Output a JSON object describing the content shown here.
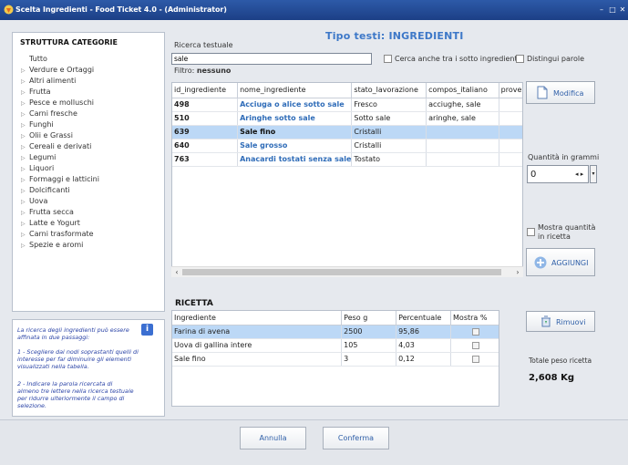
{
  "window": {
    "title": "Scelta Ingredienti - Food Ticket 4.0 - (Administrator)"
  },
  "categories": {
    "header": "STRUTTURA CATEGORIE",
    "items": [
      "Tutto",
      "Verdure e Ortaggi",
      "Altri alimenti",
      "Frutta",
      "Pesce e molluschi",
      "Carni fresche",
      "Funghi",
      "Olii e Grassi",
      "Cereali e derivati",
      "Legumi",
      "Liquori",
      "Formaggi e latticini",
      "Dolcificanti",
      "Uova",
      "Frutta secca",
      "Latte e Yogurt",
      "Carni trasformate",
      "Spezie e aromi"
    ]
  },
  "info": {
    "text1": "La ricerca degli ingredienti può essere affinata in due passaggi:",
    "text2": "1 - Scegliere dai nodi soprastanti quelli di interesse per far diminuire gli elementi visualizzati nella tabella.",
    "text3": "2 - Indicare la parola ricercata di almeno tre lettere nella ricerca testuale per ridurre ulteriormente il campo di selezione."
  },
  "header": {
    "tipo_label": "Tipo testi:",
    "tipo_value": "INGREDIENTI"
  },
  "search": {
    "label": "Ricerca testuale",
    "value": "sale",
    "filter_label": "Filtro:",
    "filter_value": "nessuno",
    "opt_sub": "Cerca anche tra i sotto ingredienti",
    "opt_words": "Distingui parole"
  },
  "ingredients": {
    "columns": [
      "id_ingrediente",
      "nome_ingrediente",
      "stato_lavorazione",
      "compos_italiano",
      "provenie"
    ],
    "rows": [
      {
        "id": "498",
        "nome": "Acciuga o alice sotto sale",
        "stato": "Fresco",
        "compos": "acciughe, sale",
        "prov": ""
      },
      {
        "id": "510",
        "nome": "Aringhe sotto sale",
        "stato": "Sotto sale",
        "compos": "aringhe, sale",
        "prov": ""
      },
      {
        "id": "639",
        "nome": "Sale fino",
        "stato": "Cristalli",
        "compos": "",
        "prov": ""
      },
      {
        "id": "640",
        "nome": "Sale grosso",
        "stato": "Cristalli",
        "compos": "",
        "prov": ""
      },
      {
        "id": "763",
        "nome": "Anacardi tostati senza sale",
        "stato": "Tostato",
        "compos": "",
        "prov": ""
      }
    ]
  },
  "actions": {
    "modifica": "Modifica",
    "qty_label": "Quantità in grammi",
    "qty_value": "0",
    "show_qty": "Mostra quantità in ricetta",
    "aggiungi": "AGGIUNGI",
    "rimuovi": "Rimuovi"
  },
  "recipe": {
    "title": "RICETTA",
    "columns": [
      "Ingrediente",
      "Peso g",
      "Percentuale",
      "Mostra %"
    ],
    "rows": [
      {
        "ing": "Farina di avena",
        "peso": "2500",
        "perc": "95,86"
      },
      {
        "ing": "Uova di gallina intere",
        "peso": "105",
        "perc": "4,03"
      },
      {
        "ing": "Sale fino",
        "peso": "3",
        "perc": "0,12"
      }
    ],
    "total_label": "Totale peso ricetta",
    "total_value": "2,608 Kg"
  },
  "footer": {
    "annulla": "Annulla",
    "conferma": "Conferma"
  },
  "colors": {
    "accent": "#3d78c8",
    "selection": "#bcd8f6",
    "titlebar": "#2d5aa8"
  }
}
